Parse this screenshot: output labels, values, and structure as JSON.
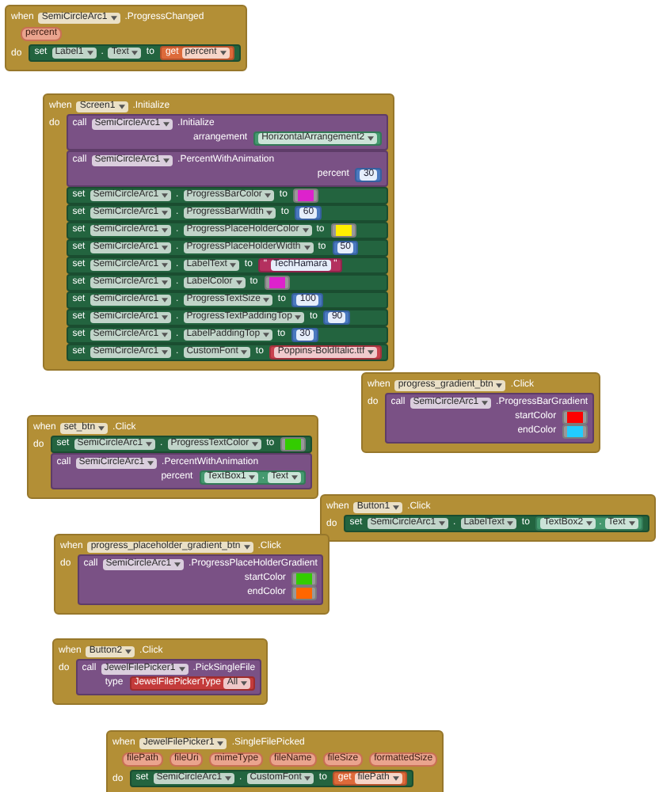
{
  "events": [
    {
      "header": [
        {
          "kind": "keyword",
          "text": "when"
        },
        {
          "kind": "dropdown",
          "text": "SemiCircleArc1"
        },
        {
          "kind": "label",
          "text": ".ProgressChanged"
        }
      ],
      "params": [
        "percent"
      ],
      "body_label": "do",
      "statements": [
        {
          "kind": "set",
          "rows": [
            {
              "tokens": [
                {
                  "kind": "keyword",
                  "text": "set"
                },
                {
                  "kind": "dropdown",
                  "text": "Label1"
                },
                {
                  "kind": "label",
                  "text": "."
                },
                {
                  "kind": "dropdown",
                  "text": "Text"
                },
                {
                  "kind": "keyword",
                  "text": "to"
                }
              ],
              "value": {
                "kind": "get",
                "tokens": [
                  {
                    "kind": "keyword",
                    "text": "get"
                  },
                  {
                    "kind": "dropdown",
                    "text": "percent"
                  }
                ]
              }
            }
          ]
        }
      ]
    },
    {
      "header": [
        {
          "kind": "keyword",
          "text": "when"
        },
        {
          "kind": "dropdown",
          "text": "Screen1"
        },
        {
          "kind": "label",
          "text": ".Initialize"
        }
      ],
      "body_label": "do",
      "statements": [
        {
          "kind": "call",
          "rows": [
            {
              "tokens": [
                {
                  "kind": "keyword",
                  "text": "call"
                },
                {
                  "kind": "dropdown",
                  "text": "SemiCircleArc1"
                },
                {
                  "kind": "label",
                  "text": ".Initialize"
                }
              ]
            },
            {
              "tokens": [
                {
                  "kind": "label",
                  "text": "arrangement"
                }
              ],
              "value": {
                "kind": "component",
                "tokens": [
                  {
                    "kind": "dropdown",
                    "text": "HorizontalArrangement2"
                  }
                ]
              }
            }
          ]
        },
        {
          "kind": "call",
          "rows": [
            {
              "tokens": [
                {
                  "kind": "keyword",
                  "text": "call"
                },
                {
                  "kind": "dropdown",
                  "text": "SemiCircleArc1"
                },
                {
                  "kind": "label",
                  "text": ".PercentWithAnimation"
                }
              ]
            },
            {
              "tokens": [
                {
                  "kind": "label",
                  "text": "percent"
                }
              ],
              "value": {
                "kind": "number",
                "tokens": [
                  {
                    "kind": "field",
                    "text": "30"
                  }
                ]
              }
            }
          ]
        },
        {
          "kind": "set",
          "rows": [
            {
              "tokens": [
                {
                  "kind": "keyword",
                  "text": "set"
                },
                {
                  "kind": "dropdown",
                  "text": "SemiCircleArc1"
                },
                {
                  "kind": "label",
                  "text": "."
                },
                {
                  "kind": "dropdown",
                  "text": "ProgressBarColor"
                },
                {
                  "kind": "keyword",
                  "text": "to"
                }
              ],
              "value": {
                "kind": "color",
                "color": "#dd22cc"
              }
            }
          ]
        },
        {
          "kind": "set",
          "rows": [
            {
              "tokens": [
                {
                  "kind": "keyword",
                  "text": "set"
                },
                {
                  "kind": "dropdown",
                  "text": "SemiCircleArc1"
                },
                {
                  "kind": "label",
                  "text": "."
                },
                {
                  "kind": "dropdown",
                  "text": "ProgressBarWidth"
                },
                {
                  "kind": "keyword",
                  "text": "to"
                }
              ],
              "value": {
                "kind": "number",
                "tokens": [
                  {
                    "kind": "field",
                    "text": "60"
                  }
                ]
              }
            }
          ]
        },
        {
          "kind": "set",
          "rows": [
            {
              "tokens": [
                {
                  "kind": "keyword",
                  "text": "set"
                },
                {
                  "kind": "dropdown",
                  "text": "SemiCircleArc1"
                },
                {
                  "kind": "label",
                  "text": "."
                },
                {
                  "kind": "dropdown",
                  "text": "ProgressPlaceHolderColor"
                },
                {
                  "kind": "keyword",
                  "text": "to"
                }
              ],
              "value": {
                "kind": "color",
                "color": "#ffee00"
              }
            }
          ]
        },
        {
          "kind": "set",
          "rows": [
            {
              "tokens": [
                {
                  "kind": "keyword",
                  "text": "set"
                },
                {
                  "kind": "dropdown",
                  "text": "SemiCircleArc1"
                },
                {
                  "kind": "label",
                  "text": "."
                },
                {
                  "kind": "dropdown",
                  "text": "ProgressPlaceHolderWidth"
                },
                {
                  "kind": "keyword",
                  "text": "to"
                }
              ],
              "value": {
                "kind": "number",
                "tokens": [
                  {
                    "kind": "field",
                    "text": "50"
                  }
                ]
              }
            }
          ]
        },
        {
          "kind": "set",
          "rows": [
            {
              "tokens": [
                {
                  "kind": "keyword",
                  "text": "set"
                },
                {
                  "kind": "dropdown",
                  "text": "SemiCircleArc1"
                },
                {
                  "kind": "label",
                  "text": "."
                },
                {
                  "kind": "dropdown",
                  "text": "LabelText"
                },
                {
                  "kind": "keyword",
                  "text": "to"
                }
              ],
              "value": {
                "kind": "string",
                "tokens": [
                  {
                    "kind": "label",
                    "text": "\""
                  },
                  {
                    "kind": "field",
                    "text": "TechHamara"
                  },
                  {
                    "kind": "label",
                    "text": "\""
                  }
                ]
              }
            }
          ]
        },
        {
          "kind": "set",
          "rows": [
            {
              "tokens": [
                {
                  "kind": "keyword",
                  "text": "set"
                },
                {
                  "kind": "dropdown",
                  "text": "SemiCircleArc1"
                },
                {
                  "kind": "label",
                  "text": "."
                },
                {
                  "kind": "dropdown",
                  "text": "LabelColor"
                },
                {
                  "kind": "keyword",
                  "text": "to"
                }
              ],
              "value": {
                "kind": "color",
                "color": "#dd22cc"
              }
            }
          ]
        },
        {
          "kind": "set",
          "rows": [
            {
              "tokens": [
                {
                  "kind": "keyword",
                  "text": "set"
                },
                {
                  "kind": "dropdown",
                  "text": "SemiCircleArc1"
                },
                {
                  "kind": "label",
                  "text": "."
                },
                {
                  "kind": "dropdown",
                  "text": "ProgressTextSize"
                },
                {
                  "kind": "keyword",
                  "text": "to"
                }
              ],
              "value": {
                "kind": "number",
                "tokens": [
                  {
                    "kind": "field",
                    "text": "100"
                  }
                ]
              }
            }
          ]
        },
        {
          "kind": "set",
          "rows": [
            {
              "tokens": [
                {
                  "kind": "keyword",
                  "text": "set"
                },
                {
                  "kind": "dropdown",
                  "text": "SemiCircleArc1"
                },
                {
                  "kind": "label",
                  "text": "."
                },
                {
                  "kind": "dropdown",
                  "text": "ProgressTextPaddingTop"
                },
                {
                  "kind": "keyword",
                  "text": "to"
                }
              ],
              "value": {
                "kind": "number",
                "tokens": [
                  {
                    "kind": "field",
                    "text": "90"
                  }
                ]
              }
            }
          ]
        },
        {
          "kind": "set",
          "rows": [
            {
              "tokens": [
                {
                  "kind": "keyword",
                  "text": "set"
                },
                {
                  "kind": "dropdown",
                  "text": "SemiCircleArc1"
                },
                {
                  "kind": "label",
                  "text": "."
                },
                {
                  "kind": "dropdown",
                  "text": "LabelPaddingTop"
                },
                {
                  "kind": "keyword",
                  "text": "to"
                }
              ],
              "value": {
                "kind": "number",
                "tokens": [
                  {
                    "kind": "field",
                    "text": "30"
                  }
                ]
              }
            }
          ]
        },
        {
          "kind": "set",
          "rows": [
            {
              "tokens": [
                {
                  "kind": "keyword",
                  "text": "set"
                },
                {
                  "kind": "dropdown",
                  "text": "SemiCircleArc1"
                },
                {
                  "kind": "label",
                  "text": "."
                },
                {
                  "kind": "dropdown",
                  "text": "CustomFont"
                },
                {
                  "kind": "keyword",
                  "text": "to"
                }
              ],
              "value": {
                "kind": "asset",
                "tokens": [
                  {
                    "kind": "dropdown",
                    "text": "Poppins-BoldItalic.ttf"
                  }
                ]
              }
            }
          ]
        }
      ]
    },
    {
      "header": [
        {
          "kind": "keyword",
          "text": "when"
        },
        {
          "kind": "dropdown",
          "text": "progress_gradient_btn"
        },
        {
          "kind": "label",
          "text": ".Click"
        }
      ],
      "body_label": "do",
      "statements": [
        {
          "kind": "call",
          "rows": [
            {
              "tokens": [
                {
                  "kind": "keyword",
                  "text": "call"
                },
                {
                  "kind": "dropdown",
                  "text": "SemiCircleArc1"
                },
                {
                  "kind": "label",
                  "text": ".ProgressBarGradient"
                }
              ]
            },
            {
              "tokens": [
                {
                  "kind": "label",
                  "text": "startColor"
                }
              ],
              "value": {
                "kind": "color",
                "color": "#ff0000"
              }
            },
            {
              "tokens": [
                {
                  "kind": "label",
                  "text": "endColor"
                }
              ],
              "value": {
                "kind": "color",
                "color": "#22ccff"
              }
            }
          ]
        }
      ]
    },
    {
      "header": [
        {
          "kind": "keyword",
          "text": "when"
        },
        {
          "kind": "dropdown",
          "text": "set_btn"
        },
        {
          "kind": "label",
          "text": ".Click"
        }
      ],
      "body_label": "do",
      "statements": [
        {
          "kind": "set",
          "rows": [
            {
              "tokens": [
                {
                  "kind": "keyword",
                  "text": "set"
                },
                {
                  "kind": "dropdown",
                  "text": "SemiCircleArc1"
                },
                {
                  "kind": "label",
                  "text": "."
                },
                {
                  "kind": "dropdown",
                  "text": "ProgressTextColor"
                },
                {
                  "kind": "keyword",
                  "text": "to"
                }
              ],
              "value": {
                "kind": "color",
                "color": "#33cc00"
              }
            }
          ]
        },
        {
          "kind": "call",
          "rows": [
            {
              "tokens": [
                {
                  "kind": "keyword",
                  "text": "call"
                },
                {
                  "kind": "dropdown",
                  "text": "SemiCircleArc1"
                },
                {
                  "kind": "label",
                  "text": ".PercentWithAnimation"
                }
              ]
            },
            {
              "tokens": [
                {
                  "kind": "label",
                  "text": "percent"
                }
              ],
              "value": {
                "kind": "property",
                "tokens": [
                  {
                    "kind": "dropdown",
                    "text": "TextBox1"
                  },
                  {
                    "kind": "label",
                    "text": "."
                  },
                  {
                    "kind": "dropdown",
                    "text": "Text"
                  }
                ]
              }
            }
          ]
        }
      ]
    },
    {
      "header": [
        {
          "kind": "keyword",
          "text": "when"
        },
        {
          "kind": "dropdown",
          "text": "Button1"
        },
        {
          "kind": "label",
          "text": ".Click"
        }
      ],
      "body_label": "do",
      "statements": [
        {
          "kind": "set",
          "rows": [
            {
              "tokens": [
                {
                  "kind": "keyword",
                  "text": "set"
                },
                {
                  "kind": "dropdown",
                  "text": "SemiCircleArc1"
                },
                {
                  "kind": "label",
                  "text": "."
                },
                {
                  "kind": "dropdown",
                  "text": "LabelText"
                },
                {
                  "kind": "keyword",
                  "text": "to"
                }
              ],
              "value": {
                "kind": "property",
                "tokens": [
                  {
                    "kind": "dropdown",
                    "text": "TextBox2"
                  },
                  {
                    "kind": "label",
                    "text": "."
                  },
                  {
                    "kind": "dropdown",
                    "text": "Text"
                  }
                ]
              }
            }
          ]
        }
      ]
    },
    {
      "header": [
        {
          "kind": "keyword",
          "text": "when"
        },
        {
          "kind": "dropdown",
          "text": "progress_placeholder_gradient_btn"
        },
        {
          "kind": "label",
          "text": ".Click"
        }
      ],
      "body_label": "do",
      "statements": [
        {
          "kind": "call",
          "rows": [
            {
              "tokens": [
                {
                  "kind": "keyword",
                  "text": "call"
                },
                {
                  "kind": "dropdown",
                  "text": "SemiCircleArc1"
                },
                {
                  "kind": "label",
                  "text": ".ProgressPlaceHolderGradient"
                }
              ]
            },
            {
              "tokens": [
                {
                  "kind": "label",
                  "text": "startColor"
                }
              ],
              "value": {
                "kind": "color",
                "color": "#33cc00"
              }
            },
            {
              "tokens": [
                {
                  "kind": "label",
                  "text": "endColor"
                }
              ],
              "value": {
                "kind": "color",
                "color": "#ff6600"
              }
            }
          ]
        }
      ]
    },
    {
      "header": [
        {
          "kind": "keyword",
          "text": "when"
        },
        {
          "kind": "dropdown",
          "text": "Button2"
        },
        {
          "kind": "label",
          "text": ".Click"
        }
      ],
      "body_label": "do",
      "statements": [
        {
          "kind": "call",
          "rows": [
            {
              "tokens": [
                {
                  "kind": "keyword",
                  "text": "call"
                },
                {
                  "kind": "dropdown",
                  "text": "JewelFilePicker1"
                },
                {
                  "kind": "label",
                  "text": ".PickSingleFile"
                }
              ]
            },
            {
              "tokens": [
                {
                  "kind": "label",
                  "text": "type"
                }
              ],
              "value": {
                "kind": "helper",
                "tokens": [
                  {
                    "kind": "label",
                    "text": "JewelFilePickerType"
                  },
                  {
                    "kind": "dropdown",
                    "text": "All"
                  }
                ]
              }
            }
          ]
        }
      ]
    },
    {
      "header": [
        {
          "kind": "keyword",
          "text": "when"
        },
        {
          "kind": "dropdown",
          "text": "JewelFilePicker1"
        },
        {
          "kind": "label",
          "text": ".SingleFilePicked"
        }
      ],
      "params": [
        "filePath",
        "fileUri",
        "mimeType",
        "fileName",
        "fileSize",
        "formattedSize"
      ],
      "body_label": "do",
      "statements": [
        {
          "kind": "set",
          "rows": [
            {
              "tokens": [
                {
                  "kind": "keyword",
                  "text": "set"
                },
                {
                  "kind": "dropdown",
                  "text": "SemiCircleArc1"
                },
                {
                  "kind": "label",
                  "text": "."
                },
                {
                  "kind": "dropdown",
                  "text": "CustomFont"
                },
                {
                  "kind": "keyword",
                  "text": "to"
                }
              ],
              "value": {
                "kind": "get",
                "tokens": [
                  {
                    "kind": "keyword",
                    "text": "get"
                  },
                  {
                    "kind": "dropdown",
                    "text": "filePath"
                  }
                ]
              }
            }
          ]
        }
      ]
    }
  ]
}
